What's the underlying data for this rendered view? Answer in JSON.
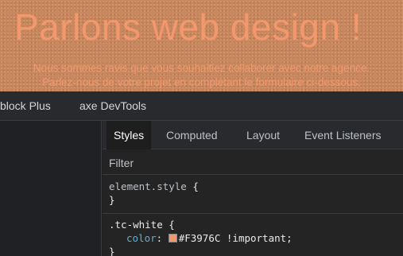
{
  "hero": {
    "title": "Parlons web design !",
    "subtitle_line1": "Nous sommes ravis que vous souhaitiez collaborer avec notre agence.",
    "subtitle_line2": "Parlez-nous de votre projet en complétant le formulaire ci-dessous.",
    "text_color": "#F3976C"
  },
  "extensions": {
    "tabs": [
      "block Plus",
      "axe DevTools"
    ]
  },
  "devtools": {
    "tabs": [
      {
        "label": "Styles",
        "active": true
      },
      {
        "label": "Computed",
        "active": false
      },
      {
        "label": "Layout",
        "active": false
      },
      {
        "label": "Event Listeners",
        "active": false
      }
    ],
    "filter": {
      "placeholder": "Filter",
      "value": ""
    },
    "rules": [
      {
        "selector": "element.style",
        "open": "{",
        "close": "}"
      },
      {
        "selector": ".tc-white",
        "open": "{",
        "declarations": [
          {
            "property": "color",
            "value": "#F3976C !important;",
            "swatch": "#F3976C"
          }
        ],
        "close": "}"
      }
    ]
  }
}
